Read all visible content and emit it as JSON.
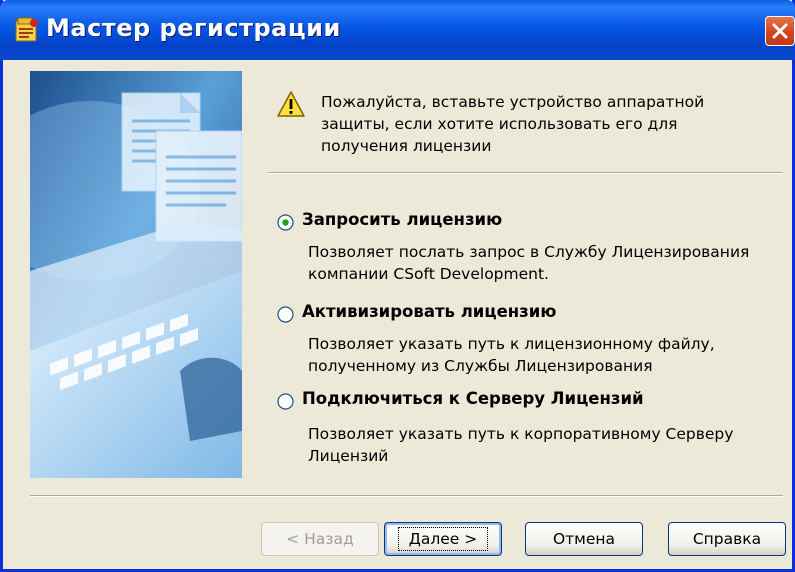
{
  "window": {
    "title": "Мастер регистрации"
  },
  "warning": {
    "icon": "warning-icon",
    "text": "Пожалуйста, вставьте устройство аппаратной защиты, если хотите использовать его для получения лицензии"
  },
  "options": [
    {
      "label": "Запросить лицензию",
      "description": "Позволяет послать запрос в Службу Лицензирования компании CSoft Development.",
      "selected": true
    },
    {
      "label": "Активизировать лицензию",
      "description": "Позволяет указать путь к лицензионному файлу, полученному из Службы Лицензирования",
      "selected": false
    },
    {
      "label": "Подключиться к Серверу Лицензий",
      "description": "Позволяет указать путь к корпоративному Серверу Лицензий",
      "selected": false
    }
  ],
  "buttons": {
    "back": "< Назад",
    "next": "Далее >",
    "cancel": "Отмена",
    "help": "Справка"
  },
  "colors": {
    "titlebar": "#0656e5",
    "close": "#d1421c",
    "dialog_bg": "#ece9d8",
    "illustration": "#2e6fb4"
  }
}
